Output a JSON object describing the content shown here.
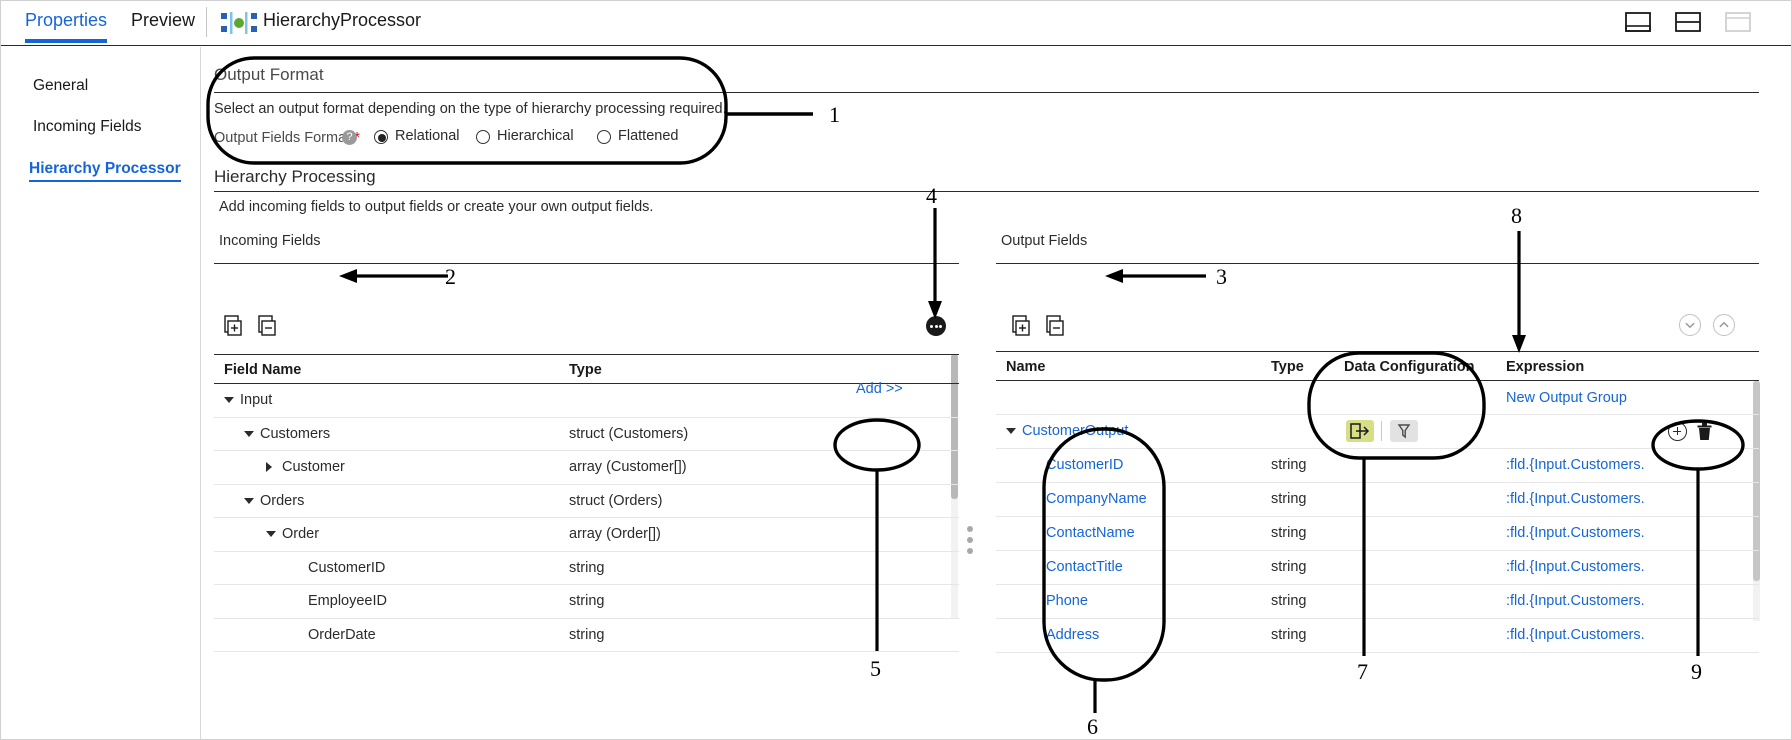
{
  "window": {
    "tabs": [
      {
        "label": "Properties",
        "active": true
      },
      {
        "label": "Preview",
        "active": false
      }
    ],
    "processor_icon": "hierarchy-processor-icon",
    "processor_name": "HierarchyProcessor",
    "layout_buttons": [
      {
        "name": "layout-single-pane-icon"
      },
      {
        "name": "layout-split-horizontal-icon"
      },
      {
        "name": "layout-maximize-icon"
      }
    ]
  },
  "sidebar": {
    "items": [
      {
        "label": "General",
        "active": false
      },
      {
        "label": "Incoming Fields",
        "active": false
      },
      {
        "label": "Hierarchy Processor",
        "active": true
      }
    ]
  },
  "output_format": {
    "title": "Output Format",
    "description": "Select an output format depending on the type of hierarchy processing required.",
    "field_label": "Output Fields Format:",
    "required_marker": "*",
    "help_glyph": "?",
    "options": [
      {
        "label": "Relational",
        "selected": true
      },
      {
        "label": "Hierarchical",
        "selected": false
      },
      {
        "label": "Flattened",
        "selected": false
      }
    ]
  },
  "hierarchy_processing": {
    "title": "Hierarchy Processing",
    "description": "Add incoming fields to output fields or create your own output fields."
  },
  "incoming_panel": {
    "label": "Incoming Fields",
    "toolbar": [
      {
        "name": "add-field-icon"
      },
      {
        "name": "remove-field-icon"
      },
      {
        "name": "more-options-icon"
      }
    ],
    "columns": [
      "Field Name",
      "Type"
    ],
    "add_button": "Add >>",
    "rows": [
      {
        "name": "Input",
        "type": "",
        "indent": 0,
        "caret": "down"
      },
      {
        "name": "Customers",
        "type": "struct (Customers)",
        "indent": 1,
        "caret": "down"
      },
      {
        "name": "Customer",
        "type": "array (Customer[])",
        "indent": 2,
        "caret": "right"
      },
      {
        "name": "Orders",
        "type": "struct (Orders)",
        "indent": 1,
        "caret": "down"
      },
      {
        "name": "Order",
        "type": "array (Order[])",
        "indent": 2,
        "caret": "down"
      },
      {
        "name": "CustomerID",
        "type": "string",
        "indent": 3,
        "caret": "none"
      },
      {
        "name": "EmployeeID",
        "type": "string",
        "indent": 3,
        "caret": "none"
      },
      {
        "name": "OrderDate",
        "type": "string",
        "indent": 3,
        "caret": "none"
      }
    ]
  },
  "output_panel": {
    "label": "Output Fields",
    "toolbar": [
      {
        "name": "add-output-field-icon"
      },
      {
        "name": "remove-output-field-icon"
      },
      {
        "name": "collapse-all-icon"
      },
      {
        "name": "expand-all-icon"
      }
    ],
    "columns": [
      "Name",
      "Type",
      "Data Configuration",
      "Expression"
    ],
    "new_group_link": "New Output Group",
    "data_config_icons": [
      {
        "name": "export-data-icon",
        "color": "#d6de86"
      },
      {
        "name": "filter-icon",
        "color": "#e2e2e2"
      }
    ],
    "row_action_icons": [
      {
        "name": "add-row-icon"
      },
      {
        "name": "delete-row-icon"
      }
    ],
    "group": {
      "name": "CustomerOutput",
      "caret": "down"
    },
    "rows": [
      {
        "name": "CustomerID",
        "type": "string",
        "expression": ":fld.{Input.Customers."
      },
      {
        "name": "CompanyName",
        "type": "string",
        "expression": ":fld.{Input.Customers."
      },
      {
        "name": "ContactName",
        "type": "string",
        "expression": ":fld.{Input.Customers."
      },
      {
        "name": "ContactTitle",
        "type": "string",
        "expression": ":fld.{Input.Customers."
      },
      {
        "name": "Phone",
        "type": "string",
        "expression": ":fld.{Input.Customers."
      },
      {
        "name": "Address",
        "type": "string",
        "expression": ":fld.{Input.Customers."
      }
    ]
  },
  "callouts": [
    {
      "number": "1"
    },
    {
      "number": "2"
    },
    {
      "number": "3"
    },
    {
      "number": "4"
    },
    {
      "number": "5"
    },
    {
      "number": "6"
    },
    {
      "number": "7"
    },
    {
      "number": "8"
    },
    {
      "number": "9"
    }
  ],
  "colors": {
    "accent_blue": "#1565d8",
    "link_blue": "#1565d8",
    "required_red": "#d00000",
    "export_green": "#d6de86",
    "filter_gray": "#e2e2e2"
  }
}
